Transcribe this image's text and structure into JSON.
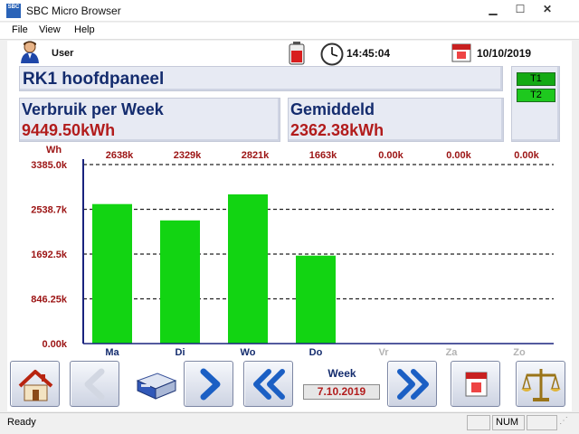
{
  "window": {
    "app_icon_text": "SBC",
    "title": "SBC Micro Browser",
    "minimize_icon": "minimize-icon",
    "maximize_icon": "maximize-icon",
    "close_icon": "close-icon"
  },
  "menu": {
    "file": "File",
    "view": "View",
    "help": "Help"
  },
  "header": {
    "user_label": "User",
    "time": "14:45:04",
    "date": "10/10/2019",
    "icons": [
      "user-icon",
      "battery-icon",
      "clock-icon",
      "calendar-icon"
    ]
  },
  "title_panel": {
    "title": "RK1 hoofdpaneel"
  },
  "tariffs": {
    "t1": "T1",
    "t2": "T2",
    "active_color": "#14aa14",
    "color": "#1ec81e"
  },
  "stats": {
    "weekly_label": "Verbruik per Week",
    "weekly_value": "9449.50kWh",
    "average_label": "Gemiddeld",
    "average_value": "2362.38kWh"
  },
  "chart_data": {
    "type": "bar",
    "ylabel": "Wh",
    "ylim": [
      0,
      3385000
    ],
    "yticks": [
      0,
      846250,
      1692500,
      2538750,
      3385000
    ],
    "ytick_labels": [
      "0.00k",
      "846.25k",
      "1692.5k",
      "2538.7k",
      "3385.0k"
    ],
    "categories": [
      "Ma",
      "Di",
      "Wo",
      "Do",
      "Vr",
      "Za",
      "Zo"
    ],
    "category_active": [
      true,
      true,
      true,
      true,
      false,
      false,
      false
    ],
    "values": [
      2638000,
      2329000,
      2821000,
      1663000,
      0,
      0,
      0
    ],
    "value_labels": [
      "2638k",
      "2329k",
      "2821k",
      "1663k",
      "0.00k",
      "0.00k",
      "0.00k"
    ],
    "bar_color": "#12d412",
    "grid": "dashed horizontal lines",
    "legend": "none"
  },
  "toolbar": {
    "icons": [
      "home-icon",
      "arrow-left-icon",
      "device-icon",
      "arrow-right-icon",
      "double-arrow-left-icon",
      "double-arrow-right-icon",
      "calendar-icon",
      "scale-icon"
    ],
    "week_label": "Week",
    "week_date": "7.10.2019"
  },
  "status": {
    "text": "Ready",
    "num": "NUM"
  },
  "colors": {
    "accent_blue": "#142c6e",
    "value_red": "#b21c1c",
    "bar_green": "#12d412"
  }
}
